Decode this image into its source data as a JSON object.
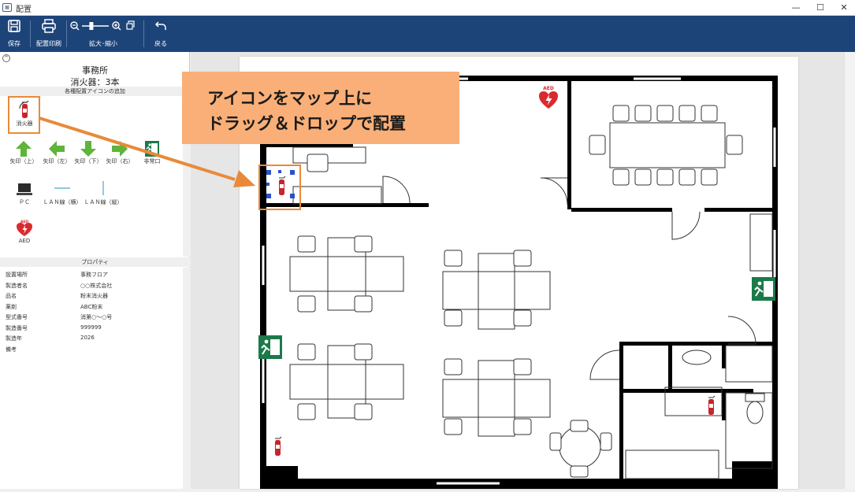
{
  "window": {
    "title": "配置",
    "app_icon": "app-icon",
    "minimize": "—",
    "maximize": "☐",
    "close": "✕"
  },
  "toolbar": {
    "save_label": "保存",
    "print_label": "配置印刷",
    "zoom_label": "拡大･縮小",
    "back_label": "戻る",
    "zoom_level": 0.35
  },
  "left": {
    "collapse_glyph": "^",
    "office_name": "事務所",
    "count": "消火器：3本",
    "add_icons_header": "各種配置アイコンの追加",
    "palette": {
      "extinguisher": "消火器",
      "arrow_up": "矢印（上）",
      "arrow_left": "矢印（左）",
      "arrow_down": "矢印（下）",
      "arrow_right": "矢印（右）",
      "exit": "非常口",
      "pc": "ＰＣ",
      "lan_h": "ＬＡＮ線（横）",
      "lan_v": "ＬＡＮ線（縦）",
      "aed": "AED"
    },
    "properties_header": "プロパティ",
    "properties": [
      {
        "key": "設置場所",
        "value": "事務フロア"
      },
      {
        "key": "製造者名",
        "value": "○○株式会社"
      },
      {
        "key": "品名",
        "value": "粉末消火器"
      },
      {
        "key": "薬剤",
        "value": "ABC粉末"
      },
      {
        "key": "型式番号",
        "value": "消第○～○号"
      },
      {
        "key": "製造番号",
        "value": "999999"
      },
      {
        "key": "製造年",
        "value": "2026"
      },
      {
        "key": "備考",
        "value": ""
      }
    ]
  },
  "callout": {
    "line1": "アイコンをマップ上に",
    "line2": "ドラッグ＆ドロップで配置"
  },
  "map": {
    "aed_label": "AED"
  },
  "colors": {
    "toolbar": "#1d4479",
    "callout": "#f9af77",
    "highlight": "#e88a3a",
    "exit_green": "#1b7a4a",
    "arrow_green": "#5fb43a",
    "extinguisher_red": "#c8242a",
    "aed_red": "#d92a2f"
  }
}
